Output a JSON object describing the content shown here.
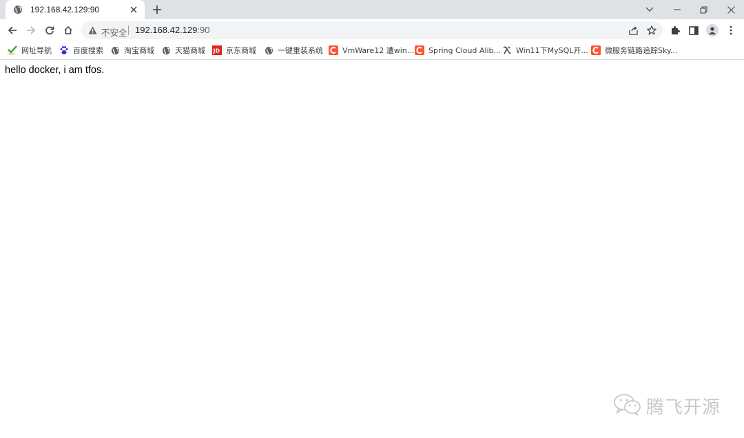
{
  "tab": {
    "title": "192.168.42.129:90"
  },
  "omnibox": {
    "security_label": "不安全",
    "host": "192.168.42.129",
    "port": ":90"
  },
  "bookmarks": [
    {
      "label": "网址导航",
      "icon": "hao-icon"
    },
    {
      "label": "百度搜索",
      "icon": "baidu-paw-icon"
    },
    {
      "label": "淘宝商城",
      "icon": "globe-icon"
    },
    {
      "label": "天猫商城",
      "icon": "globe-icon"
    },
    {
      "label": "京东商城",
      "icon": "jd-icon"
    },
    {
      "label": "一键重装系统",
      "icon": "globe-icon"
    },
    {
      "label": "VmWare12 遭win...",
      "icon": "csdn-icon"
    },
    {
      "label": "Spring Cloud Alib...",
      "icon": "csdn-icon"
    },
    {
      "label": "Win11下MySQL开...",
      "icon": "script-icon"
    },
    {
      "label": "微服务链路追踪Sky...",
      "icon": "csdn-icon"
    }
  ],
  "page": {
    "text": "hello docker, i am tfos."
  },
  "watermark": {
    "text": "腾飞开源"
  },
  "colors": {
    "tabstrip": "#dee1e6",
    "omnibox": "#f1f3f4",
    "csdn": "#fc5531",
    "jd": "#e1251b",
    "hao_green": "#3ba33b"
  }
}
